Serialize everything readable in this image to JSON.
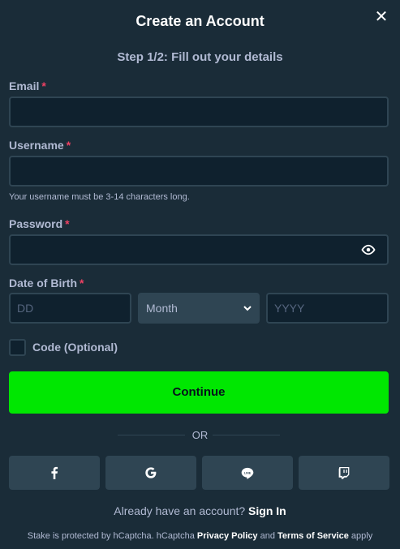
{
  "modal": {
    "title": "Create an Account",
    "close_icon": "close-icon",
    "step": "Step 1/2: Fill out your details"
  },
  "fields": {
    "email": {
      "label": "Email",
      "required": "*",
      "value": ""
    },
    "username": {
      "label": "Username",
      "required": "*",
      "value": "",
      "hint": "Your username must be 3-14 characters long."
    },
    "password": {
      "label": "Password",
      "required": "*",
      "value": "",
      "toggle_icon": "eye-icon"
    },
    "dob": {
      "label": "Date of Birth",
      "required": "*",
      "day_placeholder": "DD",
      "month_selected": "Month",
      "year_placeholder": "YYYY"
    },
    "code": {
      "label": "Code (Optional)",
      "checked": false
    }
  },
  "actions": {
    "continue_label": "Continue",
    "or_label": "OR"
  },
  "social": [
    {
      "name": "facebook",
      "icon": "facebook-icon"
    },
    {
      "name": "google",
      "icon": "google-icon"
    },
    {
      "name": "line",
      "icon": "line-icon"
    },
    {
      "name": "twitch",
      "icon": "twitch-icon"
    }
  ],
  "signin": {
    "prompt": "Already have an account?",
    "link": "Sign In"
  },
  "footer": {
    "text_before": "Stake is protected by hCaptcha. hCaptcha",
    "privacy": "Privacy Policy",
    "and": "and",
    "terms": "Terms of Service",
    "after": "apply"
  },
  "colors": {
    "background": "#1a2c38",
    "input_bg": "#0f212e",
    "border": "#2f4553",
    "accent": "#00e701",
    "required": "#ed4163",
    "text": "#b1bad3"
  }
}
